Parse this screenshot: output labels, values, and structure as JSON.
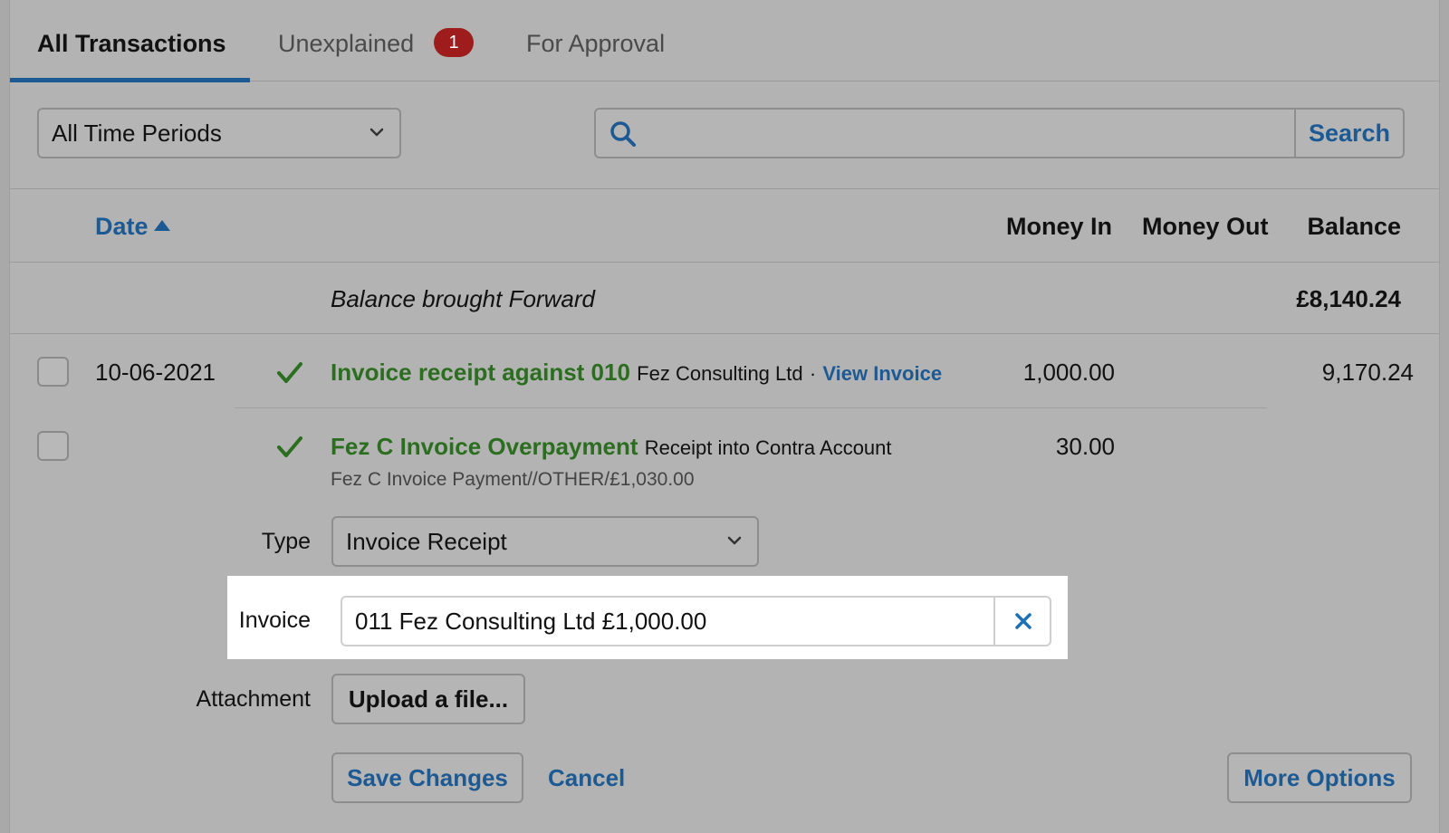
{
  "tabs": [
    {
      "label": "All Transactions",
      "active": true
    },
    {
      "label": "Unexplained",
      "badge": "1"
    },
    {
      "label": "For Approval"
    }
  ],
  "filters": {
    "period": "All Time Periods",
    "search_placeholder": "",
    "search_button": "Search"
  },
  "columns": {
    "date": "Date",
    "money_in": "Money In",
    "money_out": "Money Out",
    "balance": "Balance"
  },
  "balance_forward": {
    "label": "Balance brought Forward",
    "amount": "£8,140.24"
  },
  "transactions": [
    {
      "date": "10-06-2021",
      "title": "Invoice receipt against 010",
      "contact": "Fez Consulting Ltd",
      "separator": "·",
      "link": "View Invoice",
      "money_in": "1,000.00",
      "balance": "9,170.24"
    },
    {
      "title": "Fez C Invoice Overpayment",
      "contact": "Receipt into Contra Account",
      "description": "Fez C Invoice Payment//OTHER/£1,030.00",
      "money_in": "30.00"
    }
  ],
  "form": {
    "type_label": "Type",
    "type_value": "Invoice Receipt",
    "invoice_label": "Invoice",
    "invoice_value": "011 Fez Consulting Ltd £1,000.00",
    "attachment_label": "Attachment",
    "upload_button": "Upload a file...",
    "save_button": "Save Changes",
    "cancel_link": "Cancel",
    "more_button": "More Options"
  },
  "colors": {
    "accent": "#1d5a93",
    "positive": "#2b6e1f",
    "badge": "#9e1c1c"
  }
}
